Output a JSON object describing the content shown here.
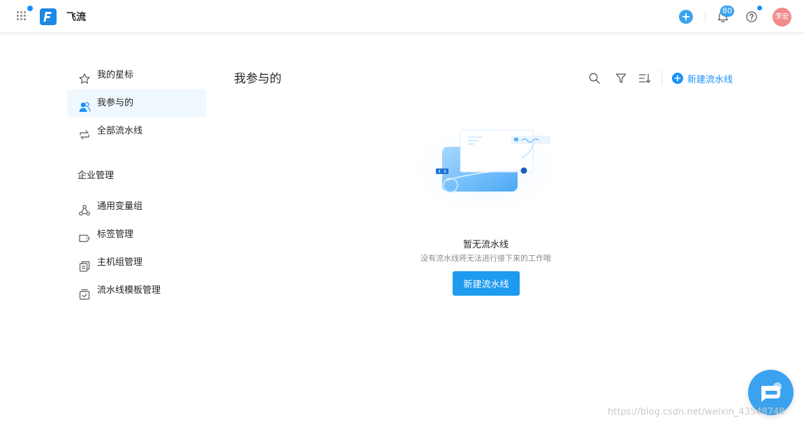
{
  "header": {
    "app_name": "飞流",
    "notifications_count": "80",
    "user_avatar_text": "李宏"
  },
  "sidebar": {
    "items": [
      {
        "label": "我的星标",
        "icon": "star-icon"
      },
      {
        "label": "我参与的",
        "icon": "user-group-icon",
        "active": true
      },
      {
        "label": "全部流水线",
        "icon": "swap-icon"
      }
    ],
    "group_title": "企业管理",
    "group_items": [
      {
        "label": "通用变量组",
        "icon": "share-nodes-icon"
      },
      {
        "label": "标签管理",
        "icon": "tag-icon"
      },
      {
        "label": "主机组管理",
        "icon": "server-stack-icon"
      },
      {
        "label": "流水线模板管理",
        "icon": "template-box-icon"
      }
    ]
  },
  "main": {
    "title": "我参与的",
    "new_pipeline_label": "新建流水线",
    "empty_title": "暂无流水线",
    "empty_description": "没有流水线将无法进行接下来的工作哦",
    "empty_button_label": "新建流水线"
  },
  "watermark": "https://blog.csdn.net/weixin_43548748",
  "colors": {
    "primary": "#1890ff",
    "active_bg": "#f0f8ff",
    "avatar_bg": "#f28b8b",
    "button_bg": "#1e9af0"
  }
}
